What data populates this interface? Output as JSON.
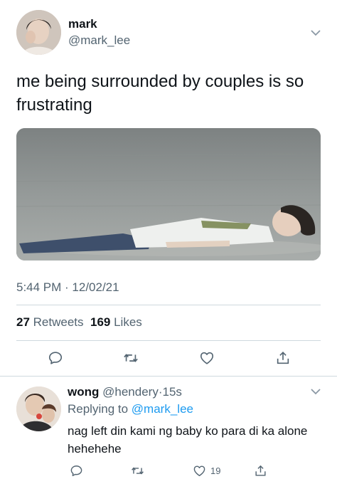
{
  "tweet": {
    "display_name": "mark",
    "handle": "@mark_lee",
    "text": "me being surrounded by couples is so frustrating",
    "timestamp": "5:44 PM · 12/02/21",
    "retweets_count": "27",
    "retweets_label": "Retweets",
    "likes_count": "169",
    "likes_label": "Likes",
    "actions": [
      "reply-icon",
      "retweet-icon",
      "like-icon",
      "share-icon"
    ]
  },
  "reply": {
    "display_name": "wong",
    "handle": "@hendery",
    "time": "15s",
    "replying_prefix": "Replying to",
    "replying_to": "@mark_lee",
    "text": "nag left din kami ng baby ko para di ka alone hehehehe",
    "likes": "19"
  },
  "colors": {
    "text": "#0f1419",
    "secondary": "#536471",
    "link": "#1d9bf0",
    "divider": "#cfd9de"
  }
}
